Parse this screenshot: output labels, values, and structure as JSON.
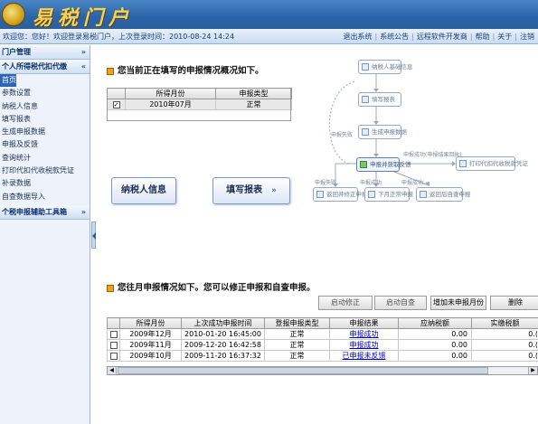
{
  "header": {
    "logo_text": "易税门户",
    "welcome": "欢迎您：您好！欢迎登录易税门户，上次登录时间：2010-08-24 14:24",
    "links": [
      "退出系统",
      "系统公告",
      "远程软件开发商",
      "帮助",
      "关于",
      "注销"
    ]
  },
  "sidebar": {
    "sections": [
      {
        "title": "门户管理",
        "chevron": "»"
      },
      {
        "title": "个人所得税代扣代缴",
        "chevron": "«"
      }
    ],
    "items": [
      "首页",
      "参数设置",
      "纳税人信息",
      "填写报表",
      "生成申报数据",
      "申报及反馈",
      "查询统计",
      "打印代扣代收税款凭证",
      "补录数据",
      "自查数据导入"
    ],
    "tools_title": "个税申报辅助工具箱",
    "tools_chevron": "»"
  },
  "current": {
    "title": "您当前正在填写的申报情况概况如下。",
    "columns": [
      "所得月份",
      "申报类型"
    ],
    "rows": [
      {
        "month": "2010年07月",
        "type": "正常"
      }
    ]
  },
  "buttons": {
    "taxpayer_info": "纳税人信息",
    "fill_report": "填写报表",
    "fill_arrow": "»"
  },
  "flow": {
    "nodes": [
      "纳税人基础信息",
      "填写报表",
      "生成申报数据",
      "申报并获取反馈",
      "打印代扣代收税款凭证",
      "返回并修正申报",
      "下月正常申报",
      "返回后自查申报"
    ],
    "notes": [
      "申报失败",
      "申报成功(申报结果回执)",
      "申报成功",
      "申报失败",
      "申报成功"
    ]
  },
  "history": {
    "title": "您往月申报情况如下。您可以修正申报和自查申报。",
    "actions": [
      "启动修正",
      "启动自查",
      "增加未申报月份",
      "删除"
    ],
    "columns": [
      "所得月份",
      "上次成功申报时间",
      "登报申报类型",
      "申报结果",
      "应纳税额",
      "实缴税额"
    ],
    "rows": [
      {
        "month": "2009年12月",
        "time": "2010-01-20 16:45:00",
        "type": "正常",
        "result": "申报成功",
        "due": "0.00",
        "paid": "0.("
      },
      {
        "month": "2009年11月",
        "time": "2009-12-20 16:42:58",
        "type": "正常",
        "result": "申报成功",
        "due": "0.00",
        "paid": "0.("
      },
      {
        "month": "2009年10月",
        "time": "2009-11-20 16:37:32",
        "type": "正常",
        "result": "已申报未反馈",
        "due": "0.00",
        "paid": "0.("
      }
    ]
  }
}
